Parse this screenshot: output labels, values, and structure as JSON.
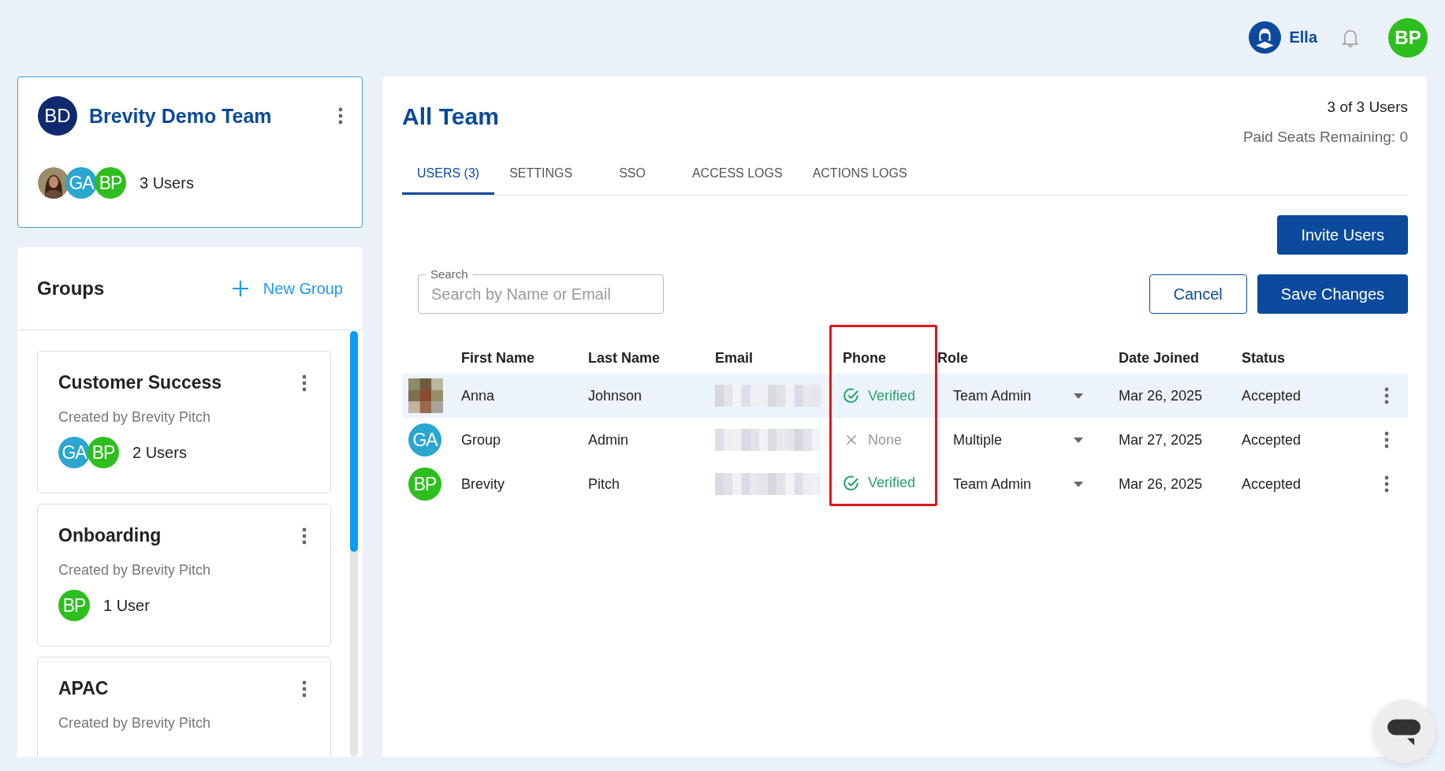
{
  "header": {
    "user_name": "Ella",
    "avatar": {
      "initials": "BP",
      "color": "#2dbf1e"
    }
  },
  "team_card": {
    "initials": "BD",
    "name": "Brevity Demo Team",
    "avatars": [
      {
        "kind": "photo"
      },
      {
        "kind": "initials",
        "initials": "GA",
        "color": "#2aa6d1"
      },
      {
        "kind": "initials",
        "initials": "BP",
        "color": "#2dbf1e"
      }
    ],
    "count": "3 Users"
  },
  "groups": {
    "title": "Groups",
    "new_button": "New Group",
    "items": [
      {
        "name": "Customer Success",
        "created_by": "Created by Brevity Pitch",
        "avatars": [
          {
            "kind": "initials",
            "initials": "GA",
            "color": "#2aa6d1"
          },
          {
            "kind": "initials",
            "initials": "BP",
            "color": "#2dbf1e"
          }
        ],
        "count": "2 Users"
      },
      {
        "name": "Onboarding",
        "created_by": "Created by Brevity Pitch",
        "avatars": [
          {
            "kind": "initials",
            "initials": "BP",
            "color": "#2dbf1e"
          }
        ],
        "count": "1 User"
      },
      {
        "name": "APAC",
        "created_by": "Created by Brevity Pitch"
      }
    ]
  },
  "main": {
    "title": "All Team",
    "user_count": "3 of 3 Users",
    "seats": "Paid Seats Remaining: 0",
    "tabs": [
      {
        "label": "USERS (3)",
        "selected": true
      },
      {
        "label": "SETTINGS",
        "selected": false
      },
      {
        "label": "SSO",
        "selected": false
      },
      {
        "label": "ACCESS LOGS",
        "selected": false
      },
      {
        "label": "ACTIONS LOGS",
        "selected": false
      }
    ],
    "invite_button": "Invite Users",
    "search": {
      "label": "Search",
      "placeholder": "Search by Name or Email"
    },
    "cancel_button": "Cancel",
    "save_button": "Save Changes",
    "table": {
      "columns": [
        {
          "label": "First Name",
          "highlighted": false
        },
        {
          "label": "Last Name",
          "highlighted": false
        },
        {
          "label": "Email",
          "highlighted": false
        },
        {
          "label": "Phone",
          "highlighted": true
        },
        {
          "label": "Role",
          "highlighted": false
        },
        {
          "label": "Date Joined",
          "highlighted": false
        },
        {
          "label": "Status",
          "highlighted": false
        }
      ],
      "rows": [
        {
          "selected": true,
          "avatar": {
            "kind": "photo"
          },
          "first": "Anna",
          "last": "Johnson",
          "phone": {
            "kind": "verified",
            "text": "Verified"
          },
          "role": "Team Admin",
          "date": "Mar 26, 2025",
          "status": "Accepted"
        },
        {
          "selected": false,
          "avatar": {
            "kind": "initials",
            "initials": "GA",
            "color": "#2aa6d1"
          },
          "first": "Group",
          "last": "Admin",
          "phone": {
            "kind": "none",
            "text": "None"
          },
          "role": "Multiple",
          "date": "Mar 27, 2025",
          "status": "Accepted"
        },
        {
          "selected": false,
          "avatar": {
            "kind": "initials",
            "initials": "BP",
            "color": "#2dbf1e"
          },
          "first": "Brevity",
          "last": "Pitch",
          "phone": {
            "kind": "verified",
            "text": "Verified"
          },
          "role": "Team Admin",
          "date": "Mar 26, 2025",
          "status": "Accepted"
        }
      ]
    }
  }
}
